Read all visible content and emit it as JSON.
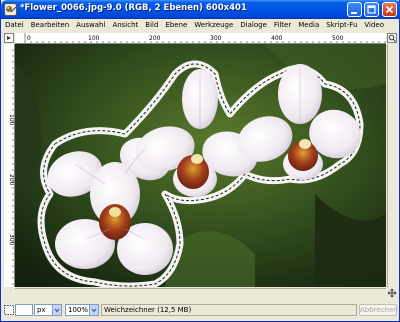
{
  "window": {
    "title": "*Flower_0066.jpg-9.0 (RGB, 2 Ebenen) 600x401"
  },
  "menu": {
    "items": [
      "Datei",
      "Bearbeiten",
      "Auswahl",
      "Ansicht",
      "Bild",
      "Ebene",
      "Werkzeuge",
      "Dialoge",
      "Filter",
      "Media",
      "Skript-Fu",
      "Video"
    ]
  },
  "ruler": {
    "h_labels": [
      "0",
      "100",
      "200",
      "300",
      "400",
      "500",
      "600"
    ],
    "v_labels": [
      "0",
      "100",
      "200",
      "300",
      "400"
    ]
  },
  "statusbar": {
    "unit": "px",
    "zoom": "100%",
    "message": "Weichzeichner (12,5 MB)",
    "cancel_label": "Abbrechen"
  },
  "icons": {
    "app": "gimp-icon",
    "minimize": "minimize-icon",
    "maximize": "maximize-icon",
    "close": "close-icon",
    "menu_arrow": "triangle-menu-icon",
    "zoom": "zoom-icon",
    "navigate": "navigate-icon",
    "quickmask": "quick-mask-icon"
  },
  "colors": {
    "titlebar": "#0055e5",
    "selection": "#ffffff",
    "background": "#ece9d8"
  }
}
